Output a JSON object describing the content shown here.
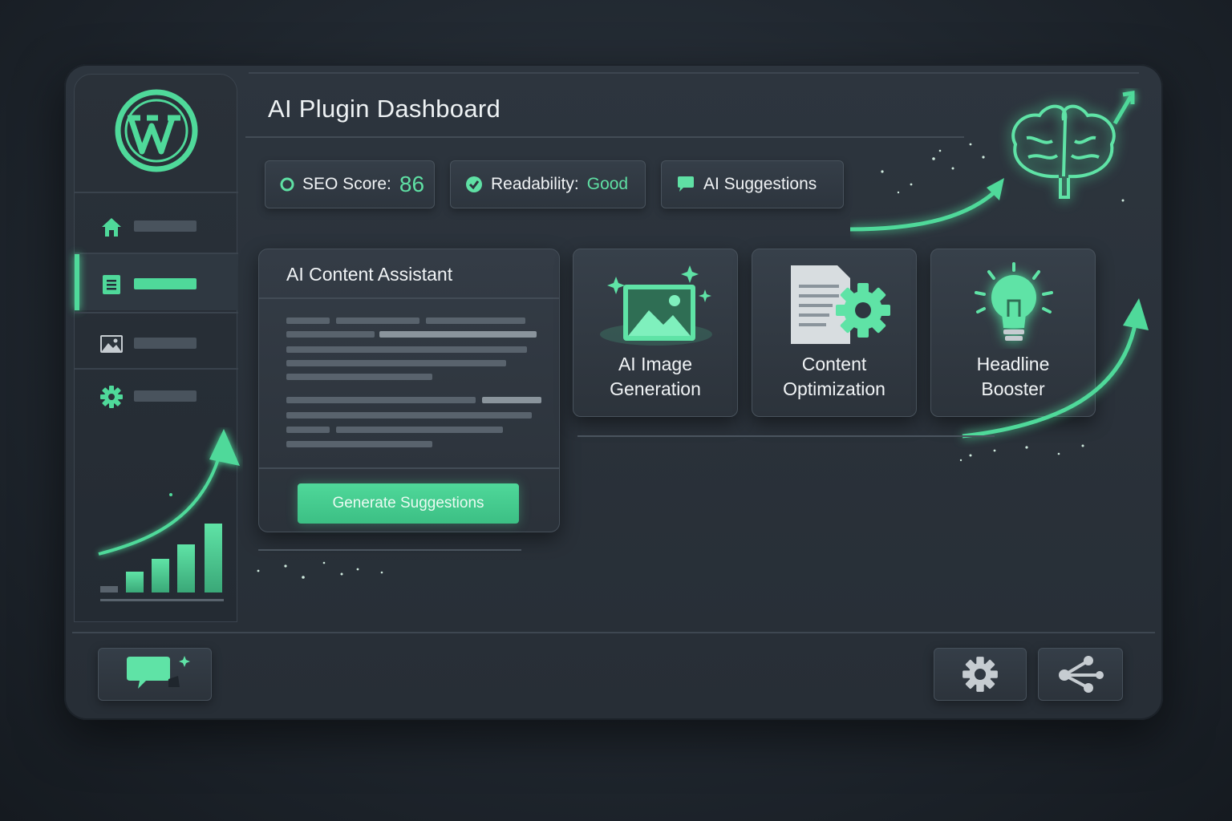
{
  "app": {
    "title": "AI Plugin Dashboard"
  },
  "sidebar": {
    "logo": "wordpress-logo",
    "items": [
      {
        "icon": "home-icon",
        "active": false
      },
      {
        "icon": "document-icon",
        "active": true
      },
      {
        "icon": "image-icon",
        "active": false
      },
      {
        "icon": "gear-icon",
        "active": false
      }
    ]
  },
  "stats": {
    "seo_label": "SEO Score:",
    "seo_value": "86",
    "readability_label": "Readability:",
    "readability_value": "Good",
    "suggestions_label": "AI Suggestions"
  },
  "assistant": {
    "title": "AI Content Assistant",
    "button_label": "Generate Suggestions"
  },
  "cards": [
    {
      "label_line1": "AI Image",
      "label_line2": "Generation",
      "icon": "image-sparkle-icon"
    },
    {
      "label_line1": "Content",
      "label_line2": "Optimization",
      "icon": "document-gear-icon"
    },
    {
      "label_line1": "Headline",
      "label_line2": "Booster",
      "icon": "lightbulb-icon"
    }
  ],
  "footer": {
    "left_icon": "chat-sparkle-icon",
    "right_icons": [
      "gear-icon",
      "share-icon"
    ]
  },
  "colors": {
    "accent": "#4fd99a",
    "background": "#20272f",
    "panel": "#2d353e"
  }
}
